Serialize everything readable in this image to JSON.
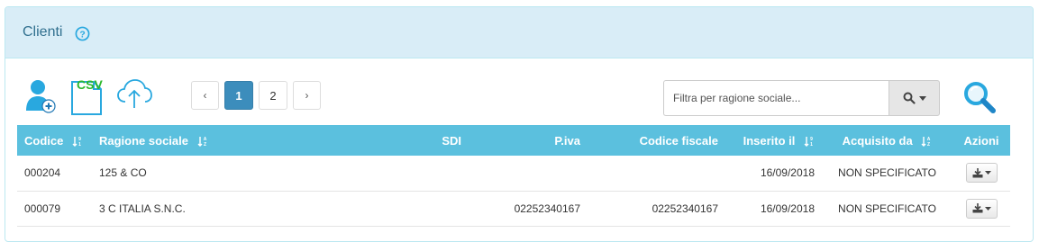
{
  "panel": {
    "title": "Clienti"
  },
  "toolbar": {
    "add_user_icon": "add-user-icon",
    "csv_label": "CSV",
    "upload_icon": "cloud-upload-icon",
    "pager": {
      "prev": "‹",
      "pages": [
        "1",
        "2"
      ],
      "active_page": "1",
      "next": "›"
    },
    "filter": {
      "placeholder": "Filtra per ragione sociale...",
      "value": ""
    },
    "search_icon": "magnifier-icon"
  },
  "table": {
    "headers": {
      "codice": "Codice",
      "ragione_sociale": "Ragione sociale",
      "sdi": "SDI",
      "piva": "P.iva",
      "codice_fiscale": "Codice fiscale",
      "inserito_il": "Inserito il",
      "acquisito_da": "Acquisito da",
      "azioni": "Azioni"
    },
    "rows": [
      {
        "codice": "000204",
        "ragione_sociale": "125 & CO",
        "sdi": "",
        "piva": "",
        "codice_fiscale": "",
        "inserito_il": "16/09/2018",
        "acquisito_da": "NON SPECIFICATO"
      },
      {
        "codice": "000079",
        "ragione_sociale": "3 C ITALIA S.N.C.",
        "sdi": "",
        "piva": "02252340167",
        "codice_fiscale": "02252340167",
        "inserito_il": "16/09/2018",
        "acquisito_da": "NON SPECIFICATO"
      }
    ]
  },
  "colors": {
    "heading_bg": "#d9edf7",
    "title_text": "#31708f",
    "table_header_bg": "#5bc0de",
    "active_page": "#3c8dbc",
    "icon_blue": "#29a8df",
    "csv_green": "#2db82d"
  }
}
